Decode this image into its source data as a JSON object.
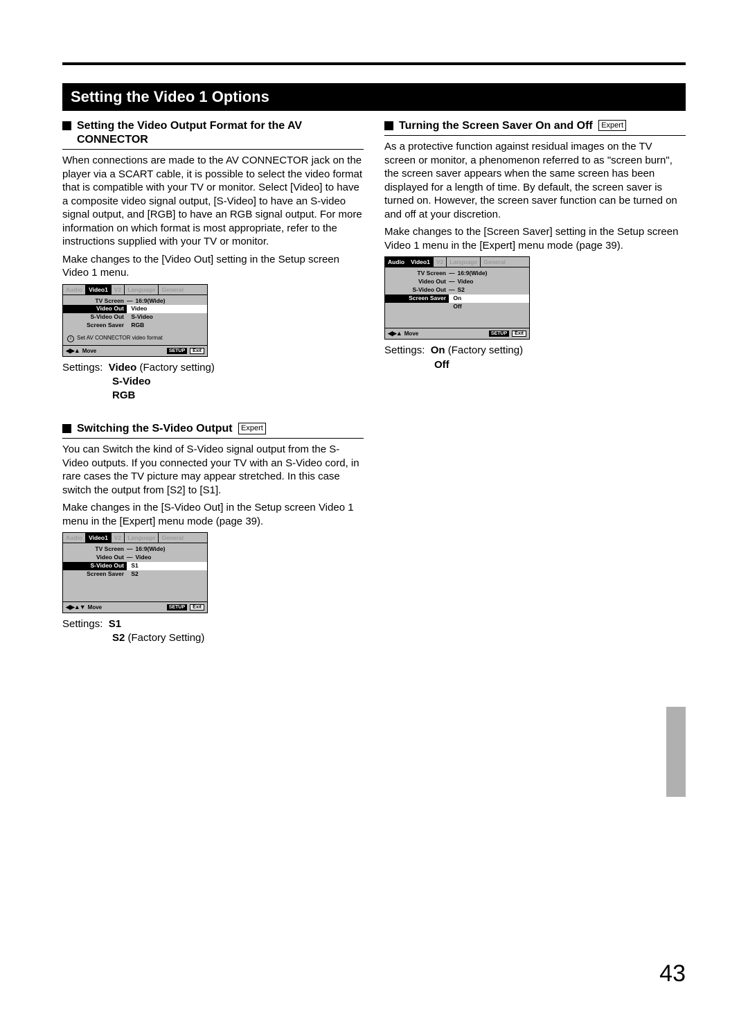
{
  "page_number": "43",
  "banner_title": "Setting the Video 1 Options",
  "expert_label": "Expert",
  "osd_common": {
    "tabs": {
      "audio": "Audio",
      "video1": "Video1",
      "v2": "V2",
      "language": "Language",
      "general": "General"
    },
    "move": "Move",
    "setup": "SETUP",
    "exit": "Exit",
    "nav3": "◀▶▲",
    "nav4": "◀▶▲▼"
  },
  "section1": {
    "title_prefix": "Setting the Video Output Format for the AV",
    "title_line2": "CONNECTOR",
    "para1": "When connections are made to the AV CONNECTOR jack on the player via a SCART cable, it is possible to select the video format that is compatible with your TV or monitor. Select [Video] to have a composite video signal output, [S-Video] to have an S-video signal output, and [RGB] to have an RGB signal output. For more information on which format is most appropriate, refer to the instructions supplied with your TV or monitor.",
    "para2": "Make changes to the [Video Out] setting in the Setup screen Video 1 menu.",
    "osd": {
      "rows": [
        {
          "label": "TV Screen",
          "dash": "—",
          "value": "16:9(Wide)"
        },
        {
          "label": "Video Out",
          "value": "Video",
          "highlight": "selected"
        },
        {
          "label": "S-Video Out",
          "value": "S-Video"
        },
        {
          "label": "Screen Saver",
          "value": "RGB"
        }
      ],
      "info": "Set AV CONNECTOR video format"
    },
    "settings_label": "Settings:",
    "opt1": "Video",
    "opt1_note": " (Factory setting)",
    "opt2": "S-Video",
    "opt3": "RGB"
  },
  "section2": {
    "title": "Switching the S-Video Output",
    "para1": "You can Switch the kind of S-Video signal output from the S-Video outputs. If you connected your TV with an S-Video cord, in rare cases the TV picture may appear stretched. In this case switch the output from [S2] to [S1].",
    "para2": "Make changes in the [S-Video Out] in the Setup screen Video 1 menu in the [Expert] menu mode (page 39).",
    "osd": {
      "rows": [
        {
          "label": "TV Screen",
          "dash": "—",
          "value": "16:9(Wide)"
        },
        {
          "label": "Video Out",
          "dash": "—",
          "value": "Video"
        },
        {
          "label": "S-Video Out",
          "value": "S1",
          "highlight": "selected"
        },
        {
          "label": "Screen Saver",
          "value": "S2"
        }
      ]
    },
    "settings_label": "Settings:",
    "opt1": "S1",
    "opt2": "S2",
    "opt2_note": " (Factory Setting)"
  },
  "section3": {
    "title": "Turning the Screen Saver On and Off",
    "para1": "As a protective function against residual images on the TV screen or monitor, a phenomenon referred to as \"screen burn\", the screen saver appears when the same screen has been displayed for a length of time. By default, the screen saver is turned on. However, the screen saver function can be turned on and off at your discretion.",
    "para2": "Make changes to the [Screen Saver] setting in the Setup screen Video 1 menu in the [Expert] menu mode (page 39).",
    "osd": {
      "rows": [
        {
          "label": "TV Screen",
          "dash": "—",
          "value": "16:9(Wide)"
        },
        {
          "label": "Video Out",
          "dash": "—",
          "value": "Video"
        },
        {
          "label": "S-Video Out",
          "dash": "—",
          "value": "S2"
        },
        {
          "label": "Screen Saver",
          "value": "On",
          "highlight": "selected"
        },
        {
          "label": "",
          "value": "Off"
        }
      ]
    },
    "settings_label": "Settings:",
    "opt1": "On",
    "opt1_note": " (Factory setting)",
    "opt2": "Off"
  }
}
